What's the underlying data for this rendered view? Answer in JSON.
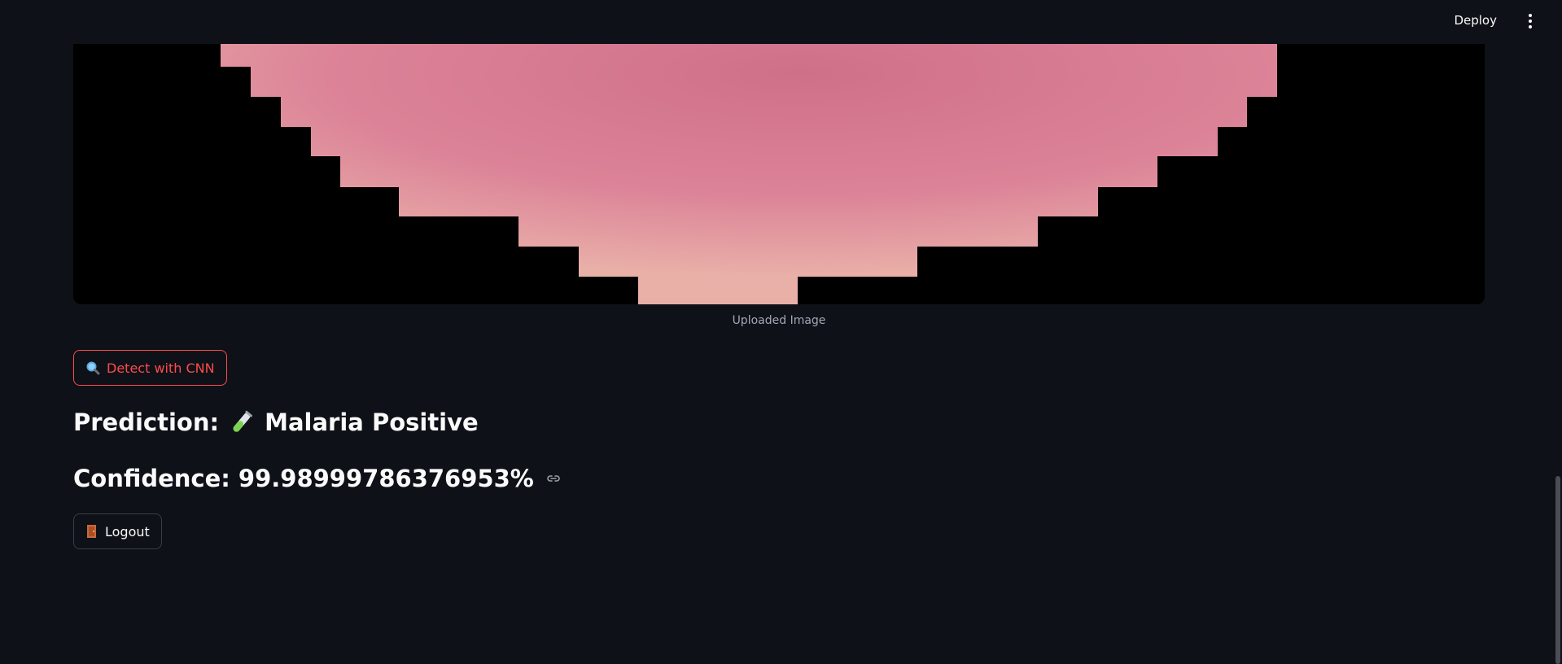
{
  "header": {
    "deploy_label": "Deploy"
  },
  "image": {
    "caption": "Uploaded Image"
  },
  "detect_button": {
    "icon": "magnifier-icon",
    "label": "Detect with CNN"
  },
  "prediction": {
    "label": "Prediction:",
    "icon": "test-tube-icon",
    "value": "Malaria Positive"
  },
  "confidence": {
    "label": "Confidence:",
    "value": "99.98999786376953%"
  },
  "logout_button": {
    "icon": "door-icon",
    "label": "Logout"
  },
  "colors": {
    "background": "#0e1117",
    "accent": "#ff4b4b",
    "text": "#fafafa",
    "cell": "#d97a94"
  }
}
